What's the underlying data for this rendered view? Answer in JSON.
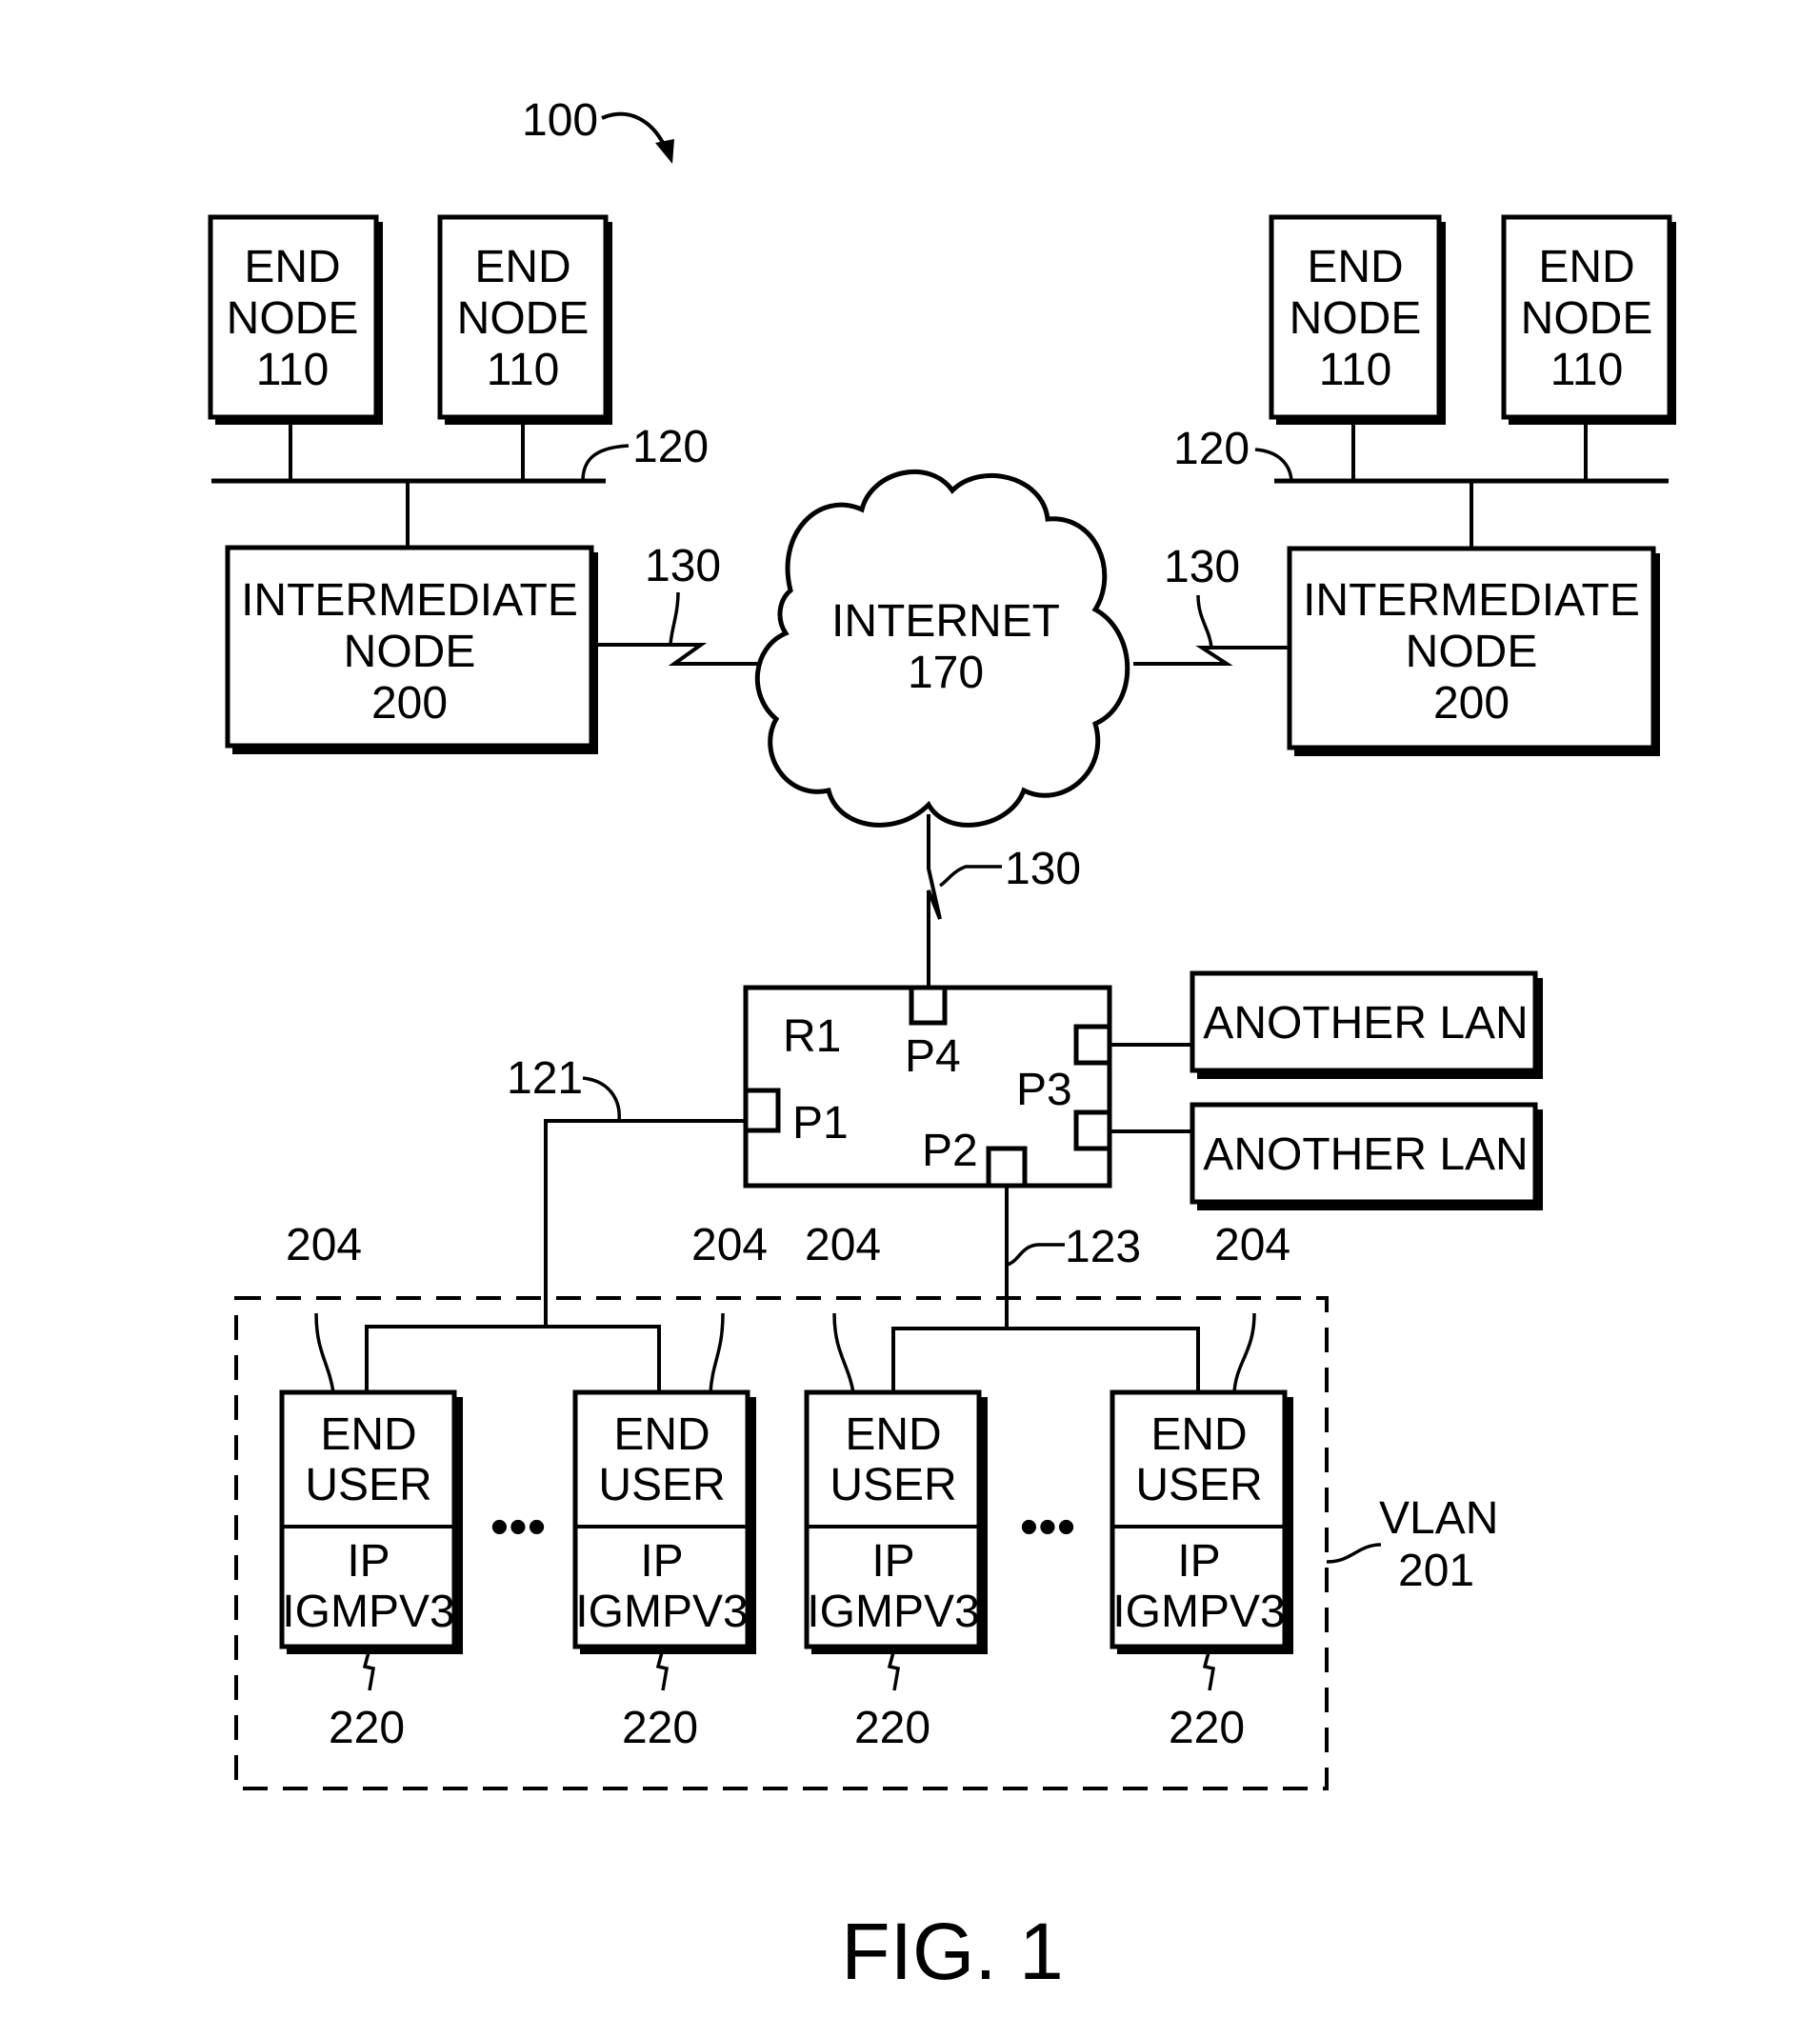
{
  "figure": {
    "reference": "100",
    "caption": "FIG. 1"
  },
  "end_nodes": [
    {
      "line1": "END",
      "line2": "NODE",
      "ref": "110"
    },
    {
      "line1": "END",
      "line2": "NODE",
      "ref": "110"
    },
    {
      "line1": "END",
      "line2": "NODE",
      "ref": "110"
    },
    {
      "line1": "END",
      "line2": "NODE",
      "ref": "110"
    }
  ],
  "buses": [
    {
      "ref": "120"
    },
    {
      "ref": "120"
    }
  ],
  "intermediate_nodes": [
    {
      "line1": "INTERMEDIATE",
      "line2": "NODE",
      "ref": "200"
    },
    {
      "line1": "INTERMEDIATE",
      "line2": "NODE",
      "ref": "200"
    }
  ],
  "links": [
    {
      "ref": "130"
    },
    {
      "ref": "130"
    },
    {
      "ref": "130"
    }
  ],
  "internet": {
    "line1": "INTERNET",
    "ref": "170"
  },
  "router": {
    "name": "R1",
    "ports": [
      "P1",
      "P2",
      "P3",
      "P4"
    ]
  },
  "other_lans": [
    {
      "label": "ANOTHER LAN"
    },
    {
      "label": "ANOTHER LAN"
    }
  ],
  "segments": [
    {
      "ref": "121"
    },
    {
      "ref": "123"
    }
  ],
  "vlan": {
    "line1": "VLAN",
    "ref": "201"
  },
  "end_users": [
    {
      "line1": "END",
      "line2": "USER",
      "line3": "IP",
      "line4": "IGMPV3",
      "port_ref": "204",
      "stack_ref": "220"
    },
    {
      "line1": "END",
      "line2": "USER",
      "line3": "IP",
      "line4": "IGMPV3",
      "port_ref": "204",
      "stack_ref": "220"
    },
    {
      "line1": "END",
      "line2": "USER",
      "line3": "IP",
      "line4": "IGMPV3",
      "port_ref": "204",
      "stack_ref": "220"
    },
    {
      "line1": "END",
      "line2": "USER",
      "line3": "IP",
      "line4": "IGMPV3",
      "port_ref": "204",
      "stack_ref": "220"
    }
  ],
  "ellipsis": "•••"
}
